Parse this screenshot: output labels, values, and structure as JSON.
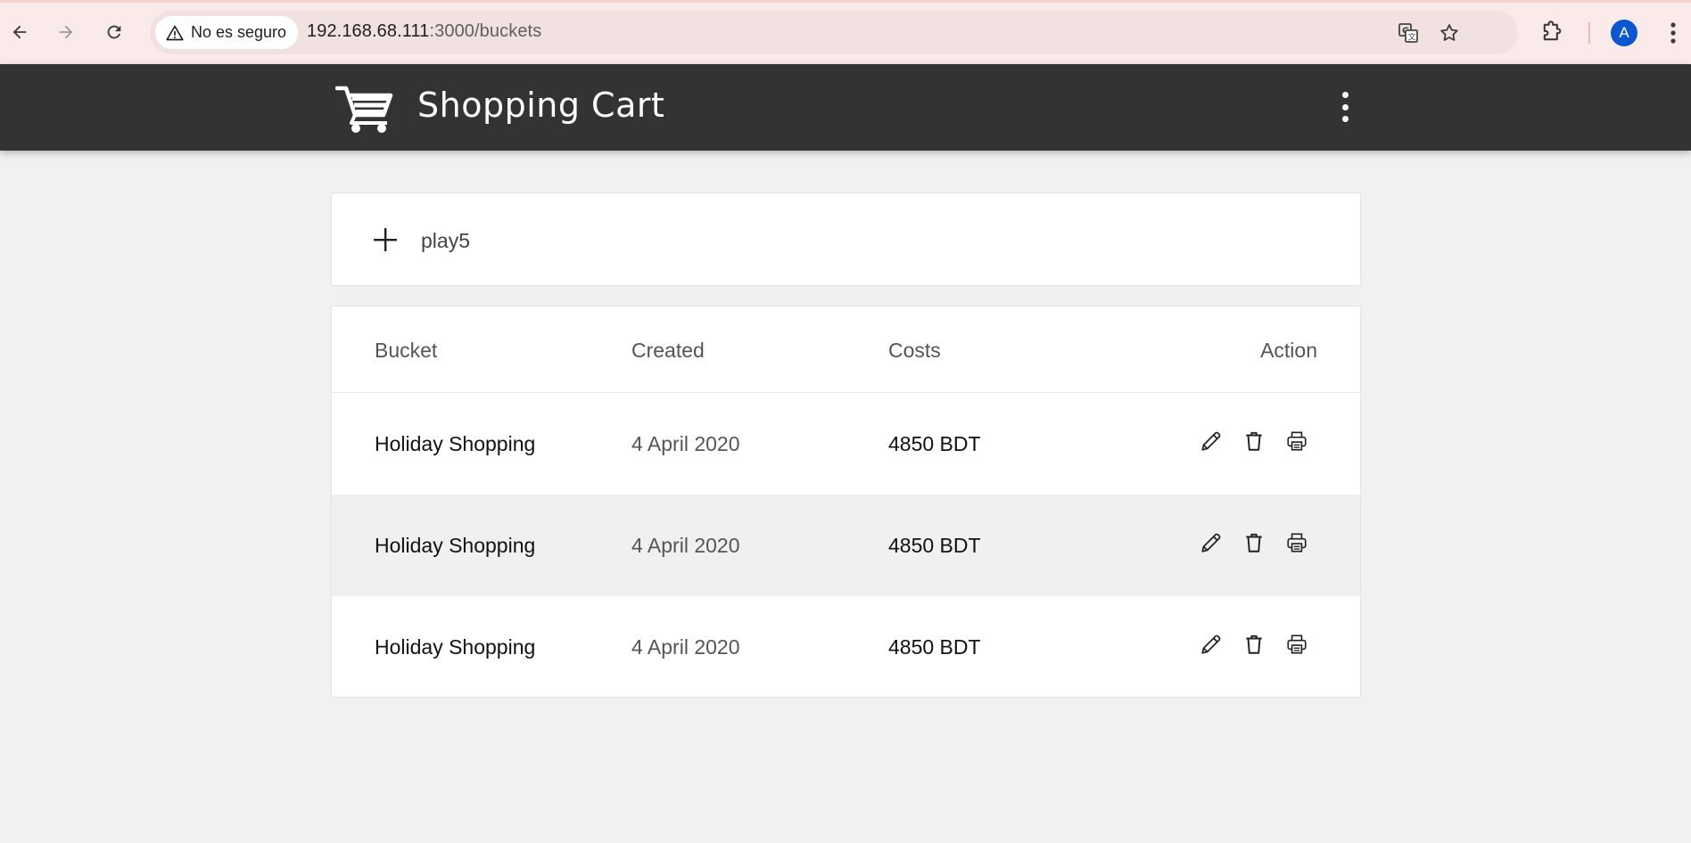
{
  "browser": {
    "security_label": "No es seguro",
    "url_host": "192.168.68.111",
    "url_rest": ":3000/buckets",
    "avatar_letter": "A",
    "icons": [
      "back-arrow-icon",
      "forward-arrow-icon",
      "reload-icon",
      "warning-icon",
      "translate-icon",
      "star-icon",
      "extensions-icon",
      "more-vert-icon"
    ],
    "accent": "#0b57d0"
  },
  "header": {
    "title": "Shopping Cart",
    "background": "#333333",
    "icons": [
      "shopping-cart-icon",
      "more-vert-icon"
    ]
  },
  "add_bucket": {
    "value": "play5",
    "icon": "plus-icon"
  },
  "table": {
    "columns": [
      "Bucket",
      "Created",
      "Costs",
      "Action"
    ],
    "rows": [
      {
        "bucket": "Holiday Shopping",
        "created": "4 April 2020",
        "costs": "4850 BDT"
      },
      {
        "bucket": "Holiday Shopping",
        "created": "4 April 2020",
        "costs": "4850 BDT"
      },
      {
        "bucket": "Holiday Shopping",
        "created": "4 April 2020",
        "costs": "4850 BDT"
      }
    ],
    "action_icons": [
      "edit-icon",
      "delete-icon",
      "print-icon"
    ]
  }
}
